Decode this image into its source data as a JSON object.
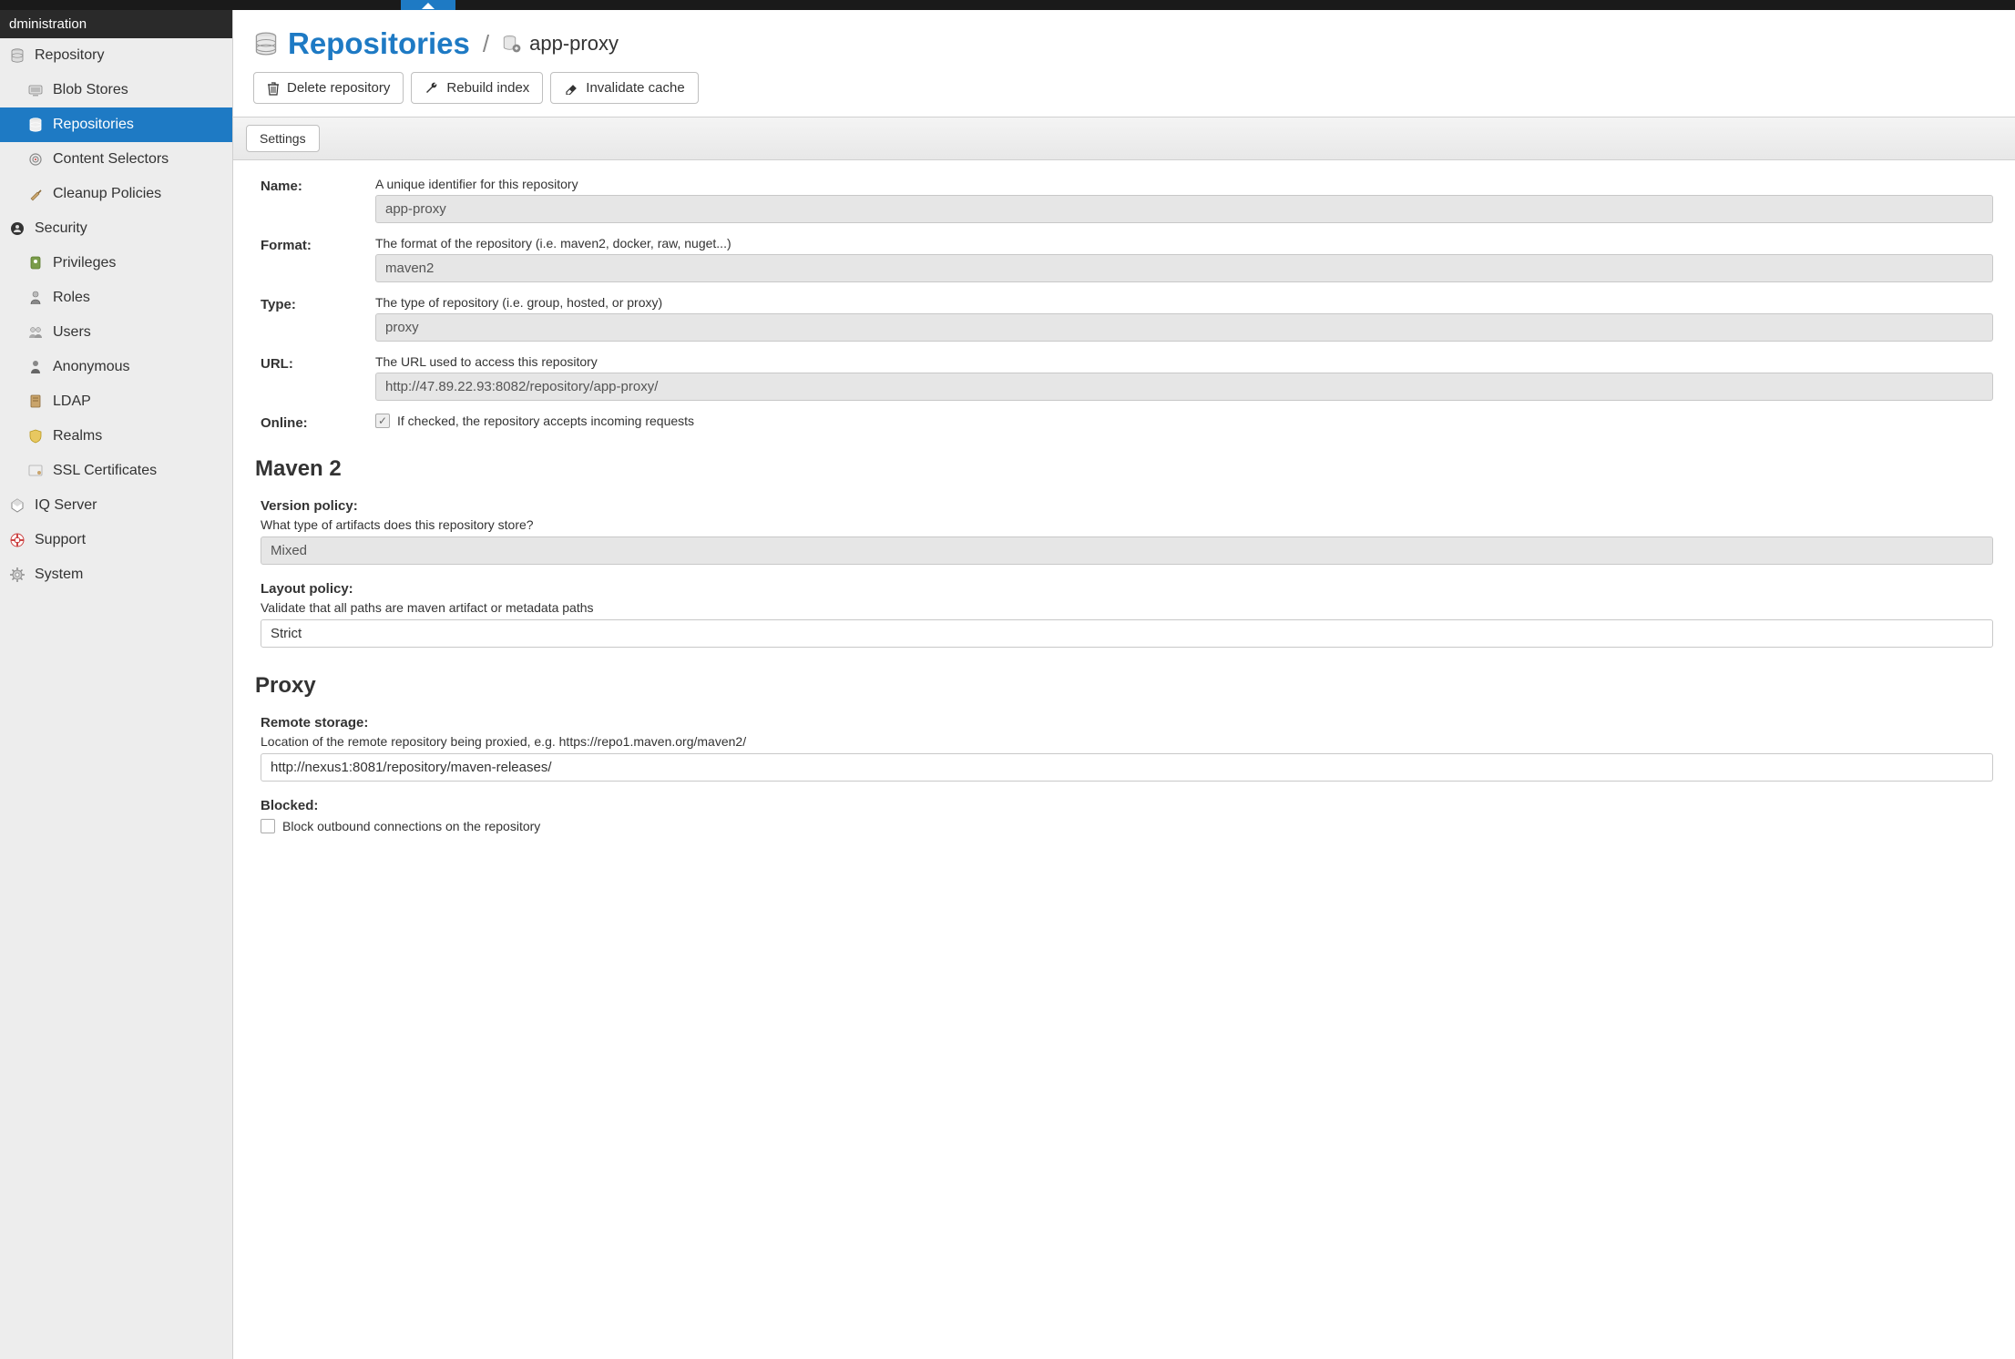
{
  "sidebar": {
    "header": "dministration",
    "sections": [
      {
        "label": "Repository",
        "items": [
          {
            "label": "Blob Stores",
            "icon": "storage-icon"
          },
          {
            "label": "Repositories",
            "icon": "database-icon",
            "active": true
          },
          {
            "label": "Content Selectors",
            "icon": "target-icon"
          },
          {
            "label": "Cleanup Policies",
            "icon": "broom-icon"
          }
        ]
      },
      {
        "label": "Security",
        "items": [
          {
            "label": "Privileges",
            "icon": "badge-icon"
          },
          {
            "label": "Roles",
            "icon": "person-icon"
          },
          {
            "label": "Users",
            "icon": "users-icon"
          },
          {
            "label": "Anonymous",
            "icon": "anon-icon"
          },
          {
            "label": "LDAP",
            "icon": "book-icon"
          },
          {
            "label": "Realms",
            "icon": "shield-icon"
          },
          {
            "label": "SSL Certificates",
            "icon": "certificate-icon"
          }
        ]
      },
      {
        "label": "IQ Server",
        "items": []
      },
      {
        "label": "Support",
        "items": []
      },
      {
        "label": "System",
        "items": []
      }
    ]
  },
  "breadcrumb": {
    "title": "Repositories",
    "current": "app-proxy"
  },
  "toolbar": {
    "delete_label": "Delete repository",
    "rebuild_label": "Rebuild index",
    "invalidate_label": "Invalidate cache"
  },
  "tabs": {
    "settings": "Settings"
  },
  "form": {
    "name": {
      "label": "Name:",
      "help": "A unique identifier for this repository",
      "value": "app-proxy"
    },
    "format": {
      "label": "Format:",
      "help": "The format of the repository (i.e. maven2, docker, raw, nuget...)",
      "value": "maven2"
    },
    "type": {
      "label": "Type:",
      "help": "The type of repository (i.e. group, hosted, or proxy)",
      "value": "proxy"
    },
    "url": {
      "label": "URL:",
      "help": "The URL used to access this repository",
      "value": "http://47.89.22.93:8082/repository/app-proxy/"
    },
    "online": {
      "label": "Online:",
      "help": "If checked, the repository accepts incoming requests",
      "checked": true
    }
  },
  "maven2": {
    "title": "Maven 2",
    "version_policy": {
      "label": "Version policy:",
      "help": "What type of artifacts does this repository store?",
      "value": "Mixed"
    },
    "layout_policy": {
      "label": "Layout policy:",
      "help": "Validate that all paths are maven artifact or metadata paths",
      "value": "Strict"
    }
  },
  "proxy": {
    "title": "Proxy",
    "remote_storage": {
      "label": "Remote storage:",
      "help": "Location of the remote repository being proxied, e.g. https://repo1.maven.org/maven2/",
      "value": "http://nexus1:8081/repository/maven-releases/"
    },
    "blocked": {
      "label": "Blocked:",
      "help": "Block outbound connections on the repository",
      "checked": false
    }
  }
}
